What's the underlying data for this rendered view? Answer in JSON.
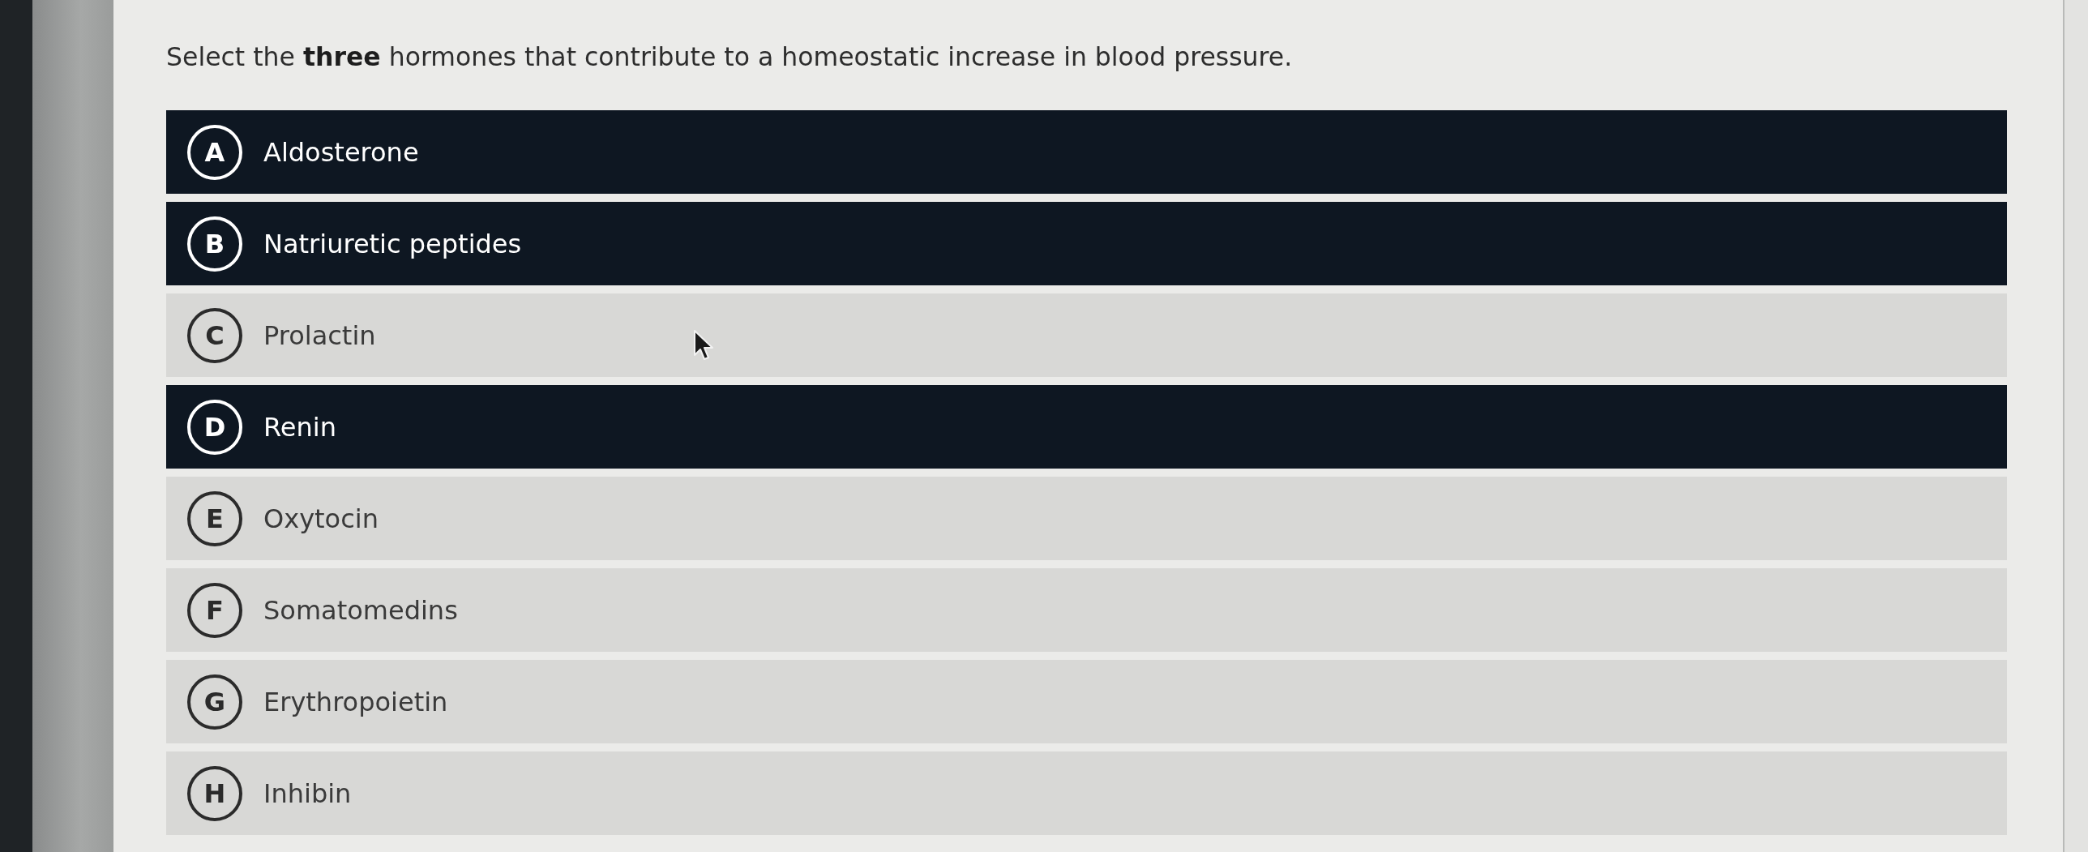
{
  "question": "Select the **three** hormones that contribute to a homeostatic increase in blood pressure.",
  "options": [
    {
      "letter": "A",
      "label": "Aldosterone",
      "selected": true
    },
    {
      "letter": "B",
      "label": "Natriuretic peptides",
      "selected": true
    },
    {
      "letter": "C",
      "label": "Prolactin",
      "selected": false
    },
    {
      "letter": "D",
      "label": "Renin",
      "selected": true
    },
    {
      "letter": "E",
      "label": "Oxytocin",
      "selected": false
    },
    {
      "letter": "F",
      "label": "Somatomedins",
      "selected": false
    },
    {
      "letter": "G",
      "label": "Erythropoietin",
      "selected": false
    },
    {
      "letter": "H",
      "label": "Inhibin",
      "selected": false
    }
  ]
}
